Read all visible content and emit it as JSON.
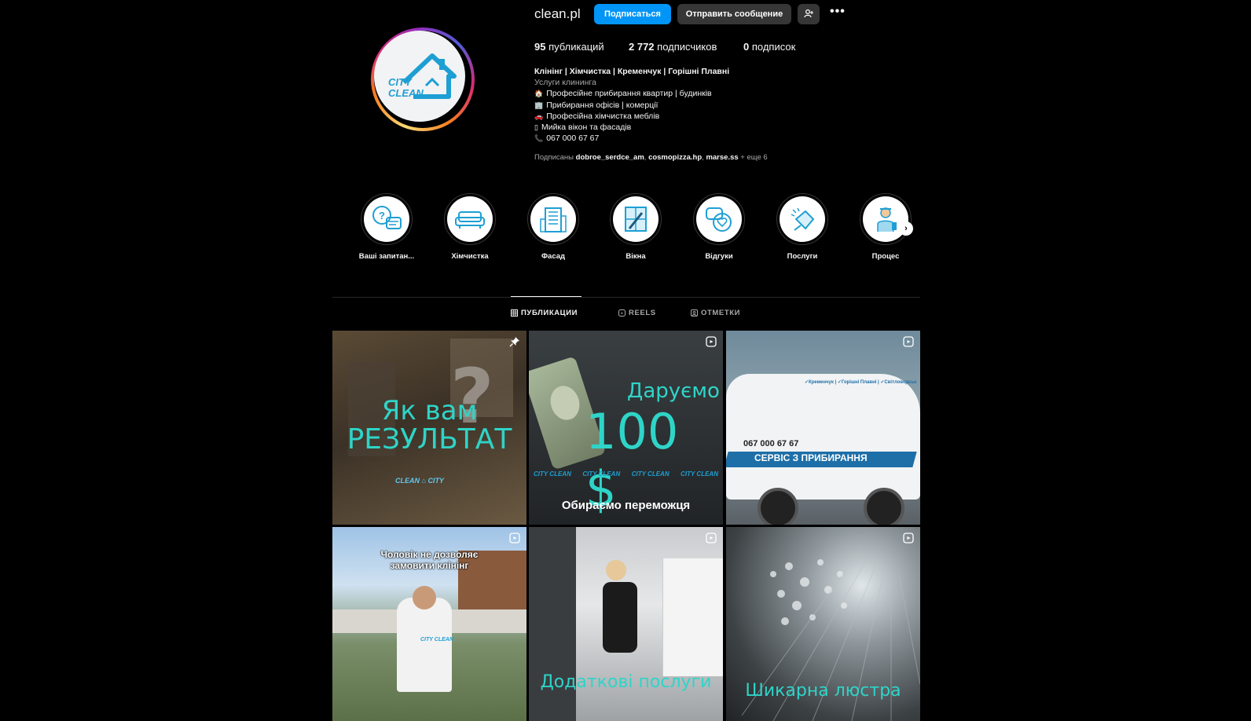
{
  "profile": {
    "username": "clean.pl",
    "follow_label": "Подписаться",
    "message_label": "Отправить сообщение",
    "more_label": "•••",
    "stats": {
      "posts_count": "95",
      "posts_label": "публикаций",
      "followers_count": "2 772",
      "followers_label": "подписчиков",
      "following_count": "0",
      "following_label": "подписок"
    },
    "avatar": {
      "line1": "CITY",
      "line2": "CLEAN"
    },
    "bio": {
      "name": "Клінінг | Хімчистка | Кременчук | Горішні Плавні",
      "category": "Услуги клининга",
      "lines": [
        {
          "icon": "🏠",
          "text": "Професійне прибирання квартир | будинків"
        },
        {
          "icon": "🏢",
          "text": "Прибирання офісів | комерції"
        },
        {
          "icon": "🚗",
          "text": "Професійна хімчистка меблів"
        },
        {
          "icon": "▯",
          "text": "Мийка вікон та фасадів"
        },
        {
          "icon": "📞",
          "text": "067 000 67 67"
        }
      ]
    },
    "followed_by": {
      "prefix": "Подписаны",
      "user1": "dobroe_serdce_am",
      "user2": "cosmopizza.hp",
      "user3": "marse.ss",
      "suffix": "+ еще 6"
    }
  },
  "highlights": [
    {
      "label": "Ваші запитан...",
      "icon": "question-chat-icon"
    },
    {
      "label": "Хімчистка",
      "icon": "sofa-icon"
    },
    {
      "label": "Фасад",
      "icon": "building-icon"
    },
    {
      "label": "Вікна",
      "icon": "window-cleaning-icon"
    },
    {
      "label": "Відгуки",
      "icon": "heart-chat-icon"
    },
    {
      "label": "Послуги",
      "icon": "cleaning-hand-icon"
    },
    {
      "label": "Процес",
      "icon": "cleaner-person-icon"
    }
  ],
  "tabs": {
    "posts": "ПУБЛИКАЦИИ",
    "reels": "REELS",
    "tagged": "ОТМЕТКИ"
  },
  "posts": [
    {
      "title_line1": "Як вам",
      "title_line2": "РЕЗУЛЬТАТ",
      "logo_left": "CLEAN",
      "logo_right": "CITY",
      "badge": "pin-icon"
    },
    {
      "title_line1": "Даруємо",
      "title_line2": "100 $",
      "logo": "CITY CLEAN",
      "caption": "Обираємо переможця",
      "badge": "reel-icon"
    },
    {
      "phone": "067 000 67 67",
      "banner": "СЕРВІС З ПРИБИРАННЯ",
      "van_top": "✓Кременчук | ✓Горішні Плавні | ✓Світловодськ",
      "badge": "reel-icon"
    },
    {
      "caption_line1": "Чоловік не дозволяє",
      "caption_line2": "замовити клінінг",
      "shirt": "CITY CLEAN",
      "badge": "reel-icon"
    },
    {
      "caption": "Додаткові послуги",
      "badge": "reel-icon"
    },
    {
      "caption": "Шикарна люстра",
      "badge": "reel-icon"
    }
  ],
  "colors": {
    "accent": "#0095f6",
    "brand": "#1e9fd4",
    "title_teal": "#2fd4c8"
  }
}
